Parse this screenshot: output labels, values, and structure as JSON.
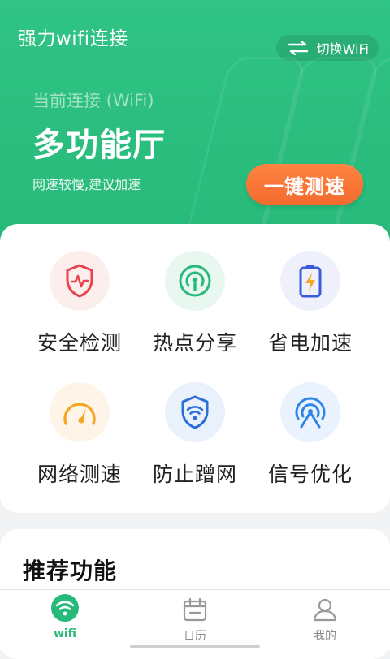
{
  "header": {
    "app_title": "强力wifi连接",
    "switch_label": "切换WiFi",
    "switch_icon": "swap-arrows-icon"
  },
  "connection": {
    "label": "当前连接 (WiFi)",
    "network_name": "多功能厅",
    "status_text": "网速较慢,建议加速",
    "speed_button": "一键测速"
  },
  "features": [
    {
      "label": "安全检测",
      "icon": "shield-pulse-icon",
      "color": "#e8424a"
    },
    {
      "label": "热点分享",
      "icon": "hotspot-icon",
      "color": "#27b979"
    },
    {
      "label": "省电加速",
      "icon": "battery-bolt-icon",
      "color": "#3b5bdb"
    },
    {
      "label": "网络测速",
      "icon": "speedometer-icon",
      "color": "#f5a623"
    },
    {
      "label": "防止蹭网",
      "icon": "wifi-shield-icon",
      "color": "#2c6fd8"
    },
    {
      "label": "信号优化",
      "icon": "signal-icon",
      "color": "#2f86e6"
    }
  ],
  "recommend": {
    "title": "推荐功能"
  },
  "tabs": [
    {
      "label": "wifi",
      "icon": "wifi-icon",
      "active": true
    },
    {
      "label": "日历",
      "icon": "calendar-icon",
      "active": false
    },
    {
      "label": "我的",
      "icon": "user-icon",
      "active": false
    }
  ],
  "colors": {
    "primary_green": "#27b979",
    "accent_orange": "#f46a2e"
  }
}
